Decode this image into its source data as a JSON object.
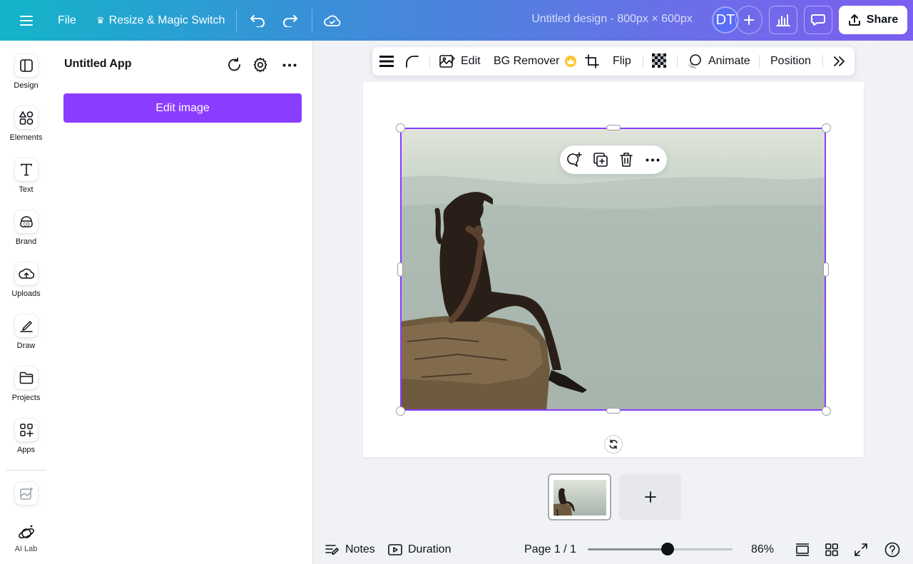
{
  "topbar": {
    "file_label": "File",
    "resize_label": "Resize & Magic Switch",
    "design_title": "Untitled design - 800px × 600px",
    "avatar_initials": "DT",
    "share_label": "Share",
    "gradient_start": "#13b4c9",
    "gradient_end": "#7b5ff0"
  },
  "rail": {
    "items": [
      {
        "label": "Design",
        "icon": "design-icon"
      },
      {
        "label": "Elements",
        "icon": "elements-icon"
      },
      {
        "label": "Text",
        "icon": "text-icon"
      },
      {
        "label": "Brand",
        "icon": "brand-icon"
      },
      {
        "label": "Uploads",
        "icon": "uploads-icon"
      },
      {
        "label": "Draw",
        "icon": "draw-icon"
      },
      {
        "label": "Projects",
        "icon": "projects-icon"
      },
      {
        "label": "Apps",
        "icon": "apps-icon"
      }
    ],
    "ai_lab_label": "AI Lab"
  },
  "panel": {
    "title": "Untitled App",
    "edit_button_label": "Edit image",
    "accent": "#8b3dff"
  },
  "toolbar": {
    "edit_label": "Edit",
    "bg_remover_label": "BG Remover",
    "flip_label": "Flip",
    "animate_label": "Animate",
    "position_label": "Position"
  },
  "canvas": {
    "selection_color": "#8b3dff"
  },
  "pages": {
    "thumb_number": "1"
  },
  "bottombar": {
    "notes_label": "Notes",
    "duration_label": "Duration",
    "page_indicator": "Page 1 / 1",
    "zoom_label": "86%",
    "zoom_value": 0.86
  }
}
